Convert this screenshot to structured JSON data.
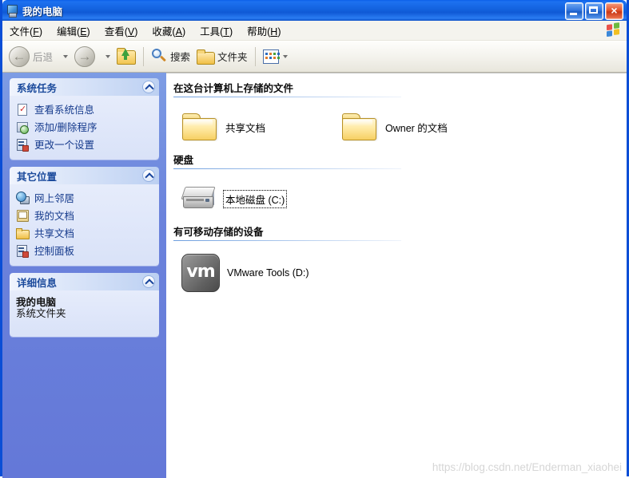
{
  "window": {
    "title": "我的电脑",
    "title_icon": "my-computer-icon",
    "buttons": {
      "minimize": "最小化",
      "maximize": "最大化",
      "close": "×"
    }
  },
  "menubar": {
    "items": [
      {
        "label": "文件",
        "accel": "F"
      },
      {
        "label": "编辑",
        "accel": "E"
      },
      {
        "label": "查看",
        "accel": "V"
      },
      {
        "label": "收藏",
        "accel": "A"
      },
      {
        "label": "工具",
        "accel": "T"
      },
      {
        "label": "帮助",
        "accel": "H"
      }
    ],
    "brand_icon": "windows-flag-icon"
  },
  "toolbar": {
    "back_label": "后退",
    "forward_label": "",
    "up_label": "",
    "search_label": "搜索",
    "folders_label": "文件夹",
    "views_label": ""
  },
  "sidebar": {
    "panels": [
      {
        "title": "系统任务",
        "collapse_icon": "chevron-up-icon",
        "items": [
          {
            "label": "查看系统信息",
            "icon": "system-info-icon"
          },
          {
            "label": "添加/删除程序",
            "icon": "add-remove-programs-icon"
          },
          {
            "label": "更改一个设置",
            "icon": "change-setting-icon"
          }
        ]
      },
      {
        "title": "其它位置",
        "collapse_icon": "chevron-up-icon",
        "items": [
          {
            "label": "网上邻居",
            "icon": "network-places-icon"
          },
          {
            "label": "我的文档",
            "icon": "my-documents-icon"
          },
          {
            "label": "共享文档",
            "icon": "shared-documents-icon"
          },
          {
            "label": "控制面板",
            "icon": "control-panel-icon"
          }
        ]
      },
      {
        "title": "详细信息",
        "collapse_icon": "chevron-up-icon",
        "detail_name": "我的电脑",
        "detail_type": "系统文件夹"
      }
    ]
  },
  "content": {
    "groups": [
      {
        "title": "在这台计算机上存储的文件",
        "items": [
          {
            "label": "共享文档",
            "icon": "folder-icon"
          },
          {
            "label": "Owner 的文档",
            "icon": "folder-icon"
          }
        ]
      },
      {
        "title": "硬盘",
        "items": [
          {
            "label": "本地磁盘 (C:)",
            "icon": "hard-disk-icon",
            "focused": true
          }
        ]
      },
      {
        "title": "有可移动存储的设备",
        "items": [
          {
            "label": "VMware Tools (D:)",
            "icon": "vmware-tools-icon",
            "glyph": "vm"
          }
        ]
      }
    ]
  },
  "watermark": "https://blog.csdn.net/Enderman_xiaohei",
  "colors": {
    "titlebar_blue": "#0f59d6",
    "window_border": "#0a4ed6",
    "sidebar_blue": "#6478d8",
    "panel_header": "#bcd0f2",
    "panel_body": "#dfe6fa",
    "link_text": "#153a8c"
  }
}
